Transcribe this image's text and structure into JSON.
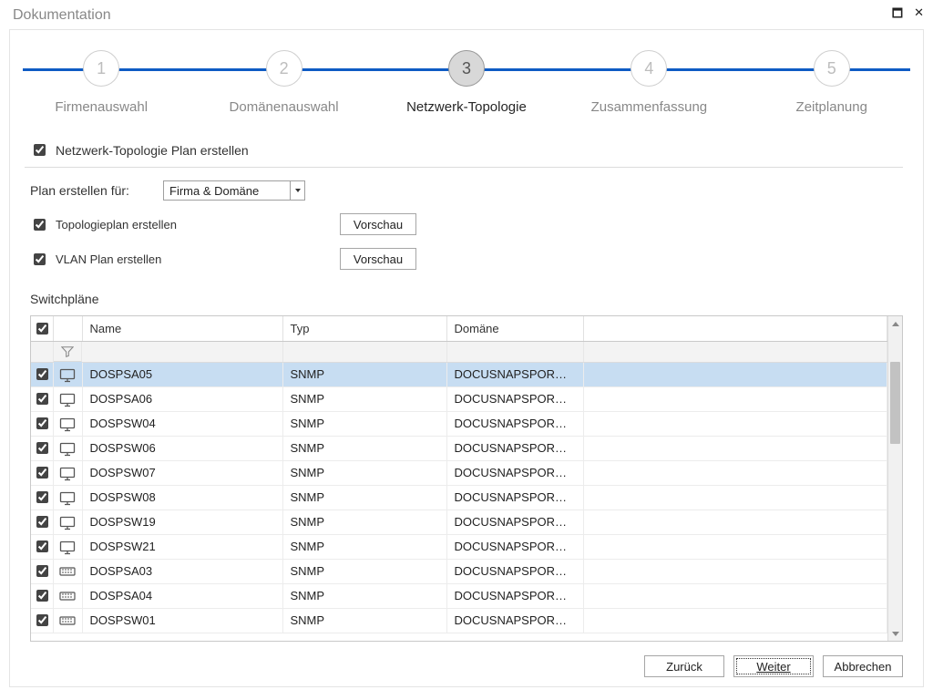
{
  "title": "Dokumentation",
  "wizard": {
    "steps": [
      {
        "num": "1",
        "label": "Firmenauswahl",
        "active": false
      },
      {
        "num": "2",
        "label": "Domänenauswahl",
        "active": false
      },
      {
        "num": "3",
        "label": "Netzwerk-Topologie",
        "active": true
      },
      {
        "num": "4",
        "label": "Zusammenfassung",
        "active": false
      },
      {
        "num": "5",
        "label": "Zeitplanung",
        "active": false
      }
    ]
  },
  "section_checkbox": "Netzwerk-Topologie Plan erstellen",
  "plan_for": {
    "label": "Plan erstellen für:",
    "value": "Firma & Domäne"
  },
  "topo": {
    "label": "Topologieplan erstellen",
    "preview": "Vorschau"
  },
  "vlan": {
    "label": "VLAN Plan erstellen",
    "preview": "Vorschau"
  },
  "switchplans": {
    "heading": "Switchpläne",
    "columns": {
      "name": "Name",
      "typ": "Typ",
      "domaene": "Domäne"
    },
    "rows": [
      {
        "name": "DOSPSA05",
        "typ": "SNMP",
        "dom": "DOCUSNAPSPOR…",
        "icon": "monitor-icon",
        "selected": true
      },
      {
        "name": "DOSPSA06",
        "typ": "SNMP",
        "dom": "DOCUSNAPSPOR…",
        "icon": "monitor-icon"
      },
      {
        "name": "DOSPSW04",
        "typ": "SNMP",
        "dom": "DOCUSNAPSPOR…",
        "icon": "monitor-icon"
      },
      {
        "name": "DOSPSW06",
        "typ": "SNMP",
        "dom": "DOCUSNAPSPOR…",
        "icon": "monitor-icon"
      },
      {
        "name": "DOSPSW07",
        "typ": "SNMP",
        "dom": "DOCUSNAPSPOR…",
        "icon": "monitor-icon"
      },
      {
        "name": "DOSPSW08",
        "typ": "SNMP",
        "dom": "DOCUSNAPSPOR…",
        "icon": "monitor-icon"
      },
      {
        "name": "DOSPSW19",
        "typ": "SNMP",
        "dom": "DOCUSNAPSPOR…",
        "icon": "monitor-icon"
      },
      {
        "name": "DOSPSW21",
        "typ": "SNMP",
        "dom": "DOCUSNAPSPOR…",
        "icon": "monitor-icon"
      },
      {
        "name": "DOSPSA03",
        "typ": "SNMP",
        "dom": "DOCUSNAPSPOR…",
        "icon": "switch-icon"
      },
      {
        "name": "DOSPSA04",
        "typ": "SNMP",
        "dom": "DOCUSNAPSPOR…",
        "icon": "switch-icon"
      },
      {
        "name": "DOSPSW01",
        "typ": "SNMP",
        "dom": "DOCUSNAPSPOR…",
        "icon": "switch-icon"
      }
    ]
  },
  "footer": {
    "back": "Zurück",
    "next": "Weiter",
    "cancel": "Abbrechen"
  }
}
